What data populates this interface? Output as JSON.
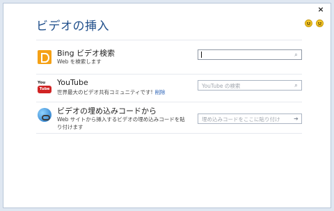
{
  "window": {
    "close_label": "×"
  },
  "dialog": {
    "title": "ビデオの挿入"
  },
  "feedback": {
    "happy_icon": "smiley-happy-icon",
    "sad_icon": "smiley-sad-icon"
  },
  "sources": [
    {
      "name": "Bing ビデオ検索",
      "desc": "Web を検索します",
      "icon": "bing-icon",
      "input_value": "",
      "placeholder": "",
      "button_icon": "search-icon",
      "button_glyph": "⌕"
    },
    {
      "name": "YouTube",
      "desc": "世界最大のビデオ共有コミュニティです!",
      "link": "削除",
      "icon": "youtube-icon",
      "icon_top": "You",
      "icon_box": "Tube",
      "input_value": "",
      "placeholder": "YouTube の検索",
      "button_icon": "search-icon",
      "button_glyph": "⌕"
    },
    {
      "name": "ビデオの埋め込みコードから",
      "desc_line1": "Web サイトから挿入するビデオの埋め込みコードを貼",
      "desc_line2": "り付けます",
      "icon": "embed-code-icon",
      "input_value": "",
      "placeholder": "埋め込みコードをここに貼り付け",
      "button_icon": "arrow-right-icon",
      "button_glyph": "➔"
    }
  ],
  "colors": {
    "title": "#1f4e8a",
    "link": "#2a62b7",
    "bing": "#f5a116",
    "youtube": "#d12424"
  }
}
